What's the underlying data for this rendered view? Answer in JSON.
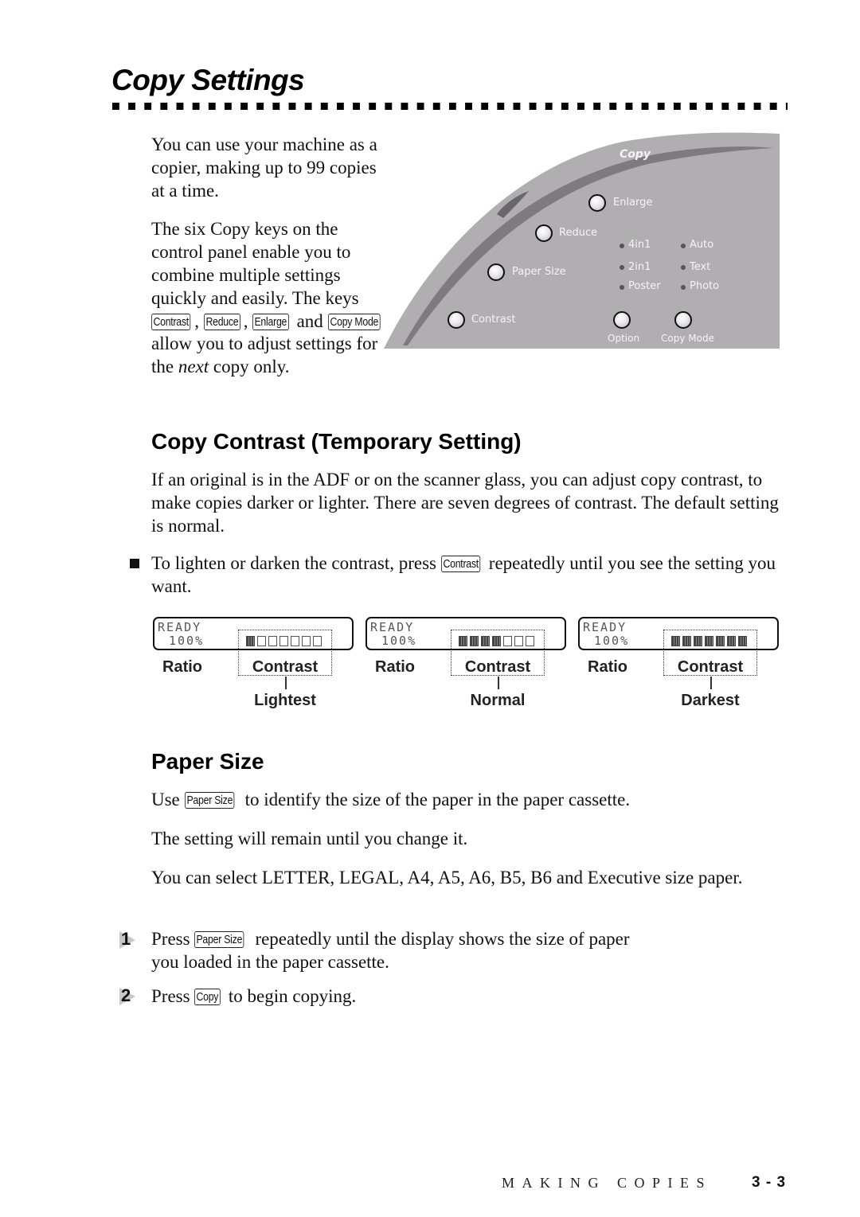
{
  "page": {
    "title": "Copy Settings",
    "footer_section": "MAKING COPIES",
    "footer_page": "3 - 3"
  },
  "intro": {
    "para1": "You can use your machine as a copier, making up to 99 copies at a time.",
    "para2_a": "The six Copy keys on the control panel enable you to combine multiple settings quickly and easily. The keys ",
    "para2_b": " and ",
    "para2_c": "allow you to adjust settings for the ",
    "para2_next": "next",
    "para2_d": " copy only.",
    "keys": [
      "Contrast",
      "Reduce",
      "Enlarge",
      "Copy Mode"
    ]
  },
  "control_panel": {
    "heading": "Copy",
    "buttons": [
      "Enlarge",
      "Reduce",
      "Paper Size",
      "Contrast",
      "Option",
      "Copy Mode"
    ],
    "leds_left": [
      "4in1",
      "2in1",
      "Poster"
    ],
    "leds_right": [
      "Auto",
      "Text",
      "Photo"
    ],
    "colors": {
      "panel": "#b1aeb2",
      "swoosh": "#7d7a80",
      "label": "#f4f4f4"
    }
  },
  "contrast_section": {
    "heading": "Copy Contrast (Temporary Setting)",
    "para": "If an original is in the ADF or on the scanner glass, you can adjust copy contrast, to make copies darker or lighter. There are seven degrees of contrast. The default setting is normal.",
    "bullet_a": "To lighten or darken the contrast, press ",
    "bullet_key": "Contrast",
    "bullet_b": " repeatedly until you see the setting you want.",
    "displays": [
      {
        "line1": "READY",
        "line2": "100%",
        "filled": 1,
        "total": 7,
        "ratio_label": "Ratio",
        "contrast_label": "Contrast",
        "level": "Lightest"
      },
      {
        "line1": "READY",
        "line2": "100%",
        "filled": 4,
        "total": 7,
        "ratio_label": "Ratio",
        "contrast_label": "Contrast",
        "level": "Normal"
      },
      {
        "line1": "READY",
        "line2": "100%",
        "filled": 7,
        "total": 7,
        "ratio_label": "Ratio",
        "contrast_label": "Contrast",
        "level": "Darkest"
      }
    ]
  },
  "paper_section": {
    "heading": "Paper Size",
    "para1_a": "Use ",
    "para1_key": "Paper Size",
    "para1_b": " to identify the size of the paper in the paper cassette.",
    "para2": "The setting will remain until you change it.",
    "para3": "You can select LETTER, LEGAL, A4, A5, A6, B5, B6 and Executive size paper.",
    "steps": [
      {
        "num": "1",
        "a": "Press ",
        "key": "Paper Size",
        "b": " repeatedly until the display shows the size of paper",
        "c": "you loaded in the paper cassette."
      },
      {
        "num": "2",
        "a": "Press ",
        "key": "Copy",
        "b": " to begin copying."
      }
    ]
  }
}
